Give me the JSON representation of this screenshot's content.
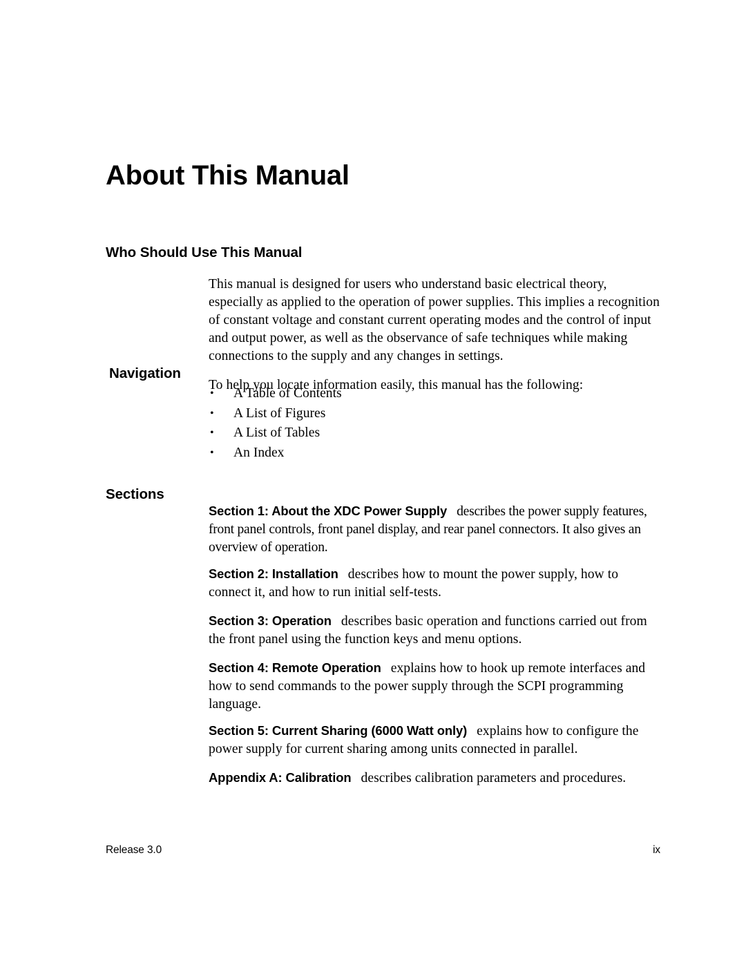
{
  "document": {
    "chapter_title": "About This Manual",
    "page_background": "#ffffff",
    "text_color": "#000000"
  },
  "sections": {
    "who_should_use": {
      "heading": "Who Should Use This Manual",
      "paragraph": "This manual is designed for users who understand basic electrical theory, especially as applied to the operation of power supplies. This implies a recognition of constant voltage and constant current operating modes and the control of input and output power, as well as the observance of safe techniques while making connections to the supply and any changes in settings."
    },
    "navigation": {
      "heading": "Navigation",
      "lead_in": "To help you locate information easily, this manual has the following:",
      "bullet_glyph": "•",
      "items": [
        "A Table of Contents",
        "A List of Figures",
        "A List of Tables",
        "An Index"
      ]
    },
    "sections_list": {
      "heading": "Sections",
      "entries": [
        {
          "label": "Section 1: About the XDC Power Supply",
          "description": "describes the power supply features, front panel controls, front panel display, and rear panel connectors. It also gives an overview of operation."
        },
        {
          "label": "Section 2: Installation",
          "description": "describes how to mount the power supply, how to connect it, and how to run initial self-tests."
        },
        {
          "label": "Section 3: Operation",
          "description": "describes basic operation and functions carried out from the front panel using the function keys and menu options."
        },
        {
          "label": "Section 4: Remote Operation",
          "description": "explains how to hook up remote interfaces and how to send commands to the power supply through the SCPI programming language."
        },
        {
          "label": "Section 5: Current Sharing (6000 Watt only)",
          "description": "explains how to configure the power supply for current sharing among units connected in parallel."
        },
        {
          "label": "Appendix A: Calibration",
          "description": "describes calibration parameters and procedures."
        }
      ]
    }
  },
  "footer": {
    "release": "Release 3.0",
    "page_number": "ix"
  }
}
